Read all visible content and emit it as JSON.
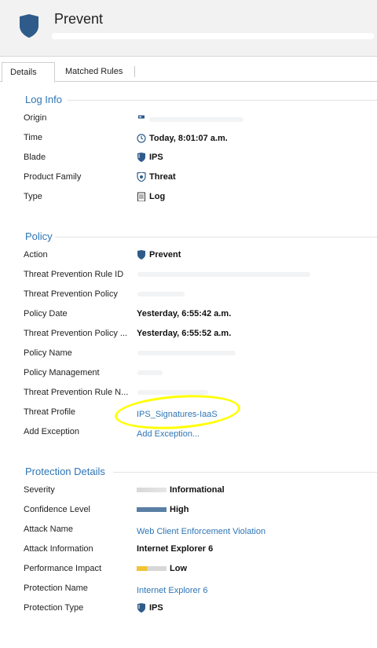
{
  "header": {
    "title": "Prevent"
  },
  "tabs": [
    {
      "label": "Details"
    },
    {
      "label": "Matched Rules"
    }
  ],
  "sections": {
    "log_info": {
      "title": "Log Info",
      "rows": [
        {
          "label": "Origin",
          "value": ""
        },
        {
          "label": "Time",
          "value": "Today, 8:01:07 a.m."
        },
        {
          "label": "Blade",
          "value": "IPS"
        },
        {
          "label": "Product Family",
          "value": "Threat"
        },
        {
          "label": "Type",
          "value": "Log"
        }
      ]
    },
    "policy": {
      "title": "Policy",
      "rows": [
        {
          "label": "Action",
          "value": "Prevent"
        },
        {
          "label": "Threat Prevention Rule ID",
          "value": ""
        },
        {
          "label": "Threat Prevention Policy",
          "value": ""
        },
        {
          "label": "Policy Date",
          "value": "Yesterday, 6:55:42 a.m."
        },
        {
          "label": "Threat Prevention Policy ...",
          "value": "Yesterday, 6:55:52 a.m."
        },
        {
          "label": "Policy Name",
          "value": ""
        },
        {
          "label": "Policy Management",
          "value": ""
        },
        {
          "label": "Threat Prevention Rule N...",
          "value": ""
        },
        {
          "label": "Threat Profile",
          "value": "IPS_Signatures-IaaS"
        },
        {
          "label": "Add Exception",
          "value": "Add Exception..."
        }
      ]
    },
    "protection": {
      "title": "Protection Details",
      "rows": [
        {
          "label": "Severity",
          "value": "Informational"
        },
        {
          "label": "Confidence Level",
          "value": "High"
        },
        {
          "label": "Attack Name",
          "value": "Web Client Enforcement Violation"
        },
        {
          "label": "Attack Information",
          "value": "Internet Explorer 6"
        },
        {
          "label": "Performance Impact",
          "value": "Low"
        },
        {
          "label": "Protection Name",
          "value": "Internet Explorer 6"
        },
        {
          "label": "Protection Type",
          "value": "IPS"
        }
      ]
    }
  },
  "colors": {
    "accent": "#2e75b6",
    "shield": "#2f5b8a",
    "highlight": "#ffff00"
  },
  "icons": {
    "header": "shield-icon",
    "origin": "gateway-icon",
    "time": "clock-icon",
    "blade": "ips-shield-icon",
    "product_family": "threat-icon",
    "type": "log-icon",
    "action": "shield-icon",
    "protection_type": "ips-shield-icon"
  }
}
